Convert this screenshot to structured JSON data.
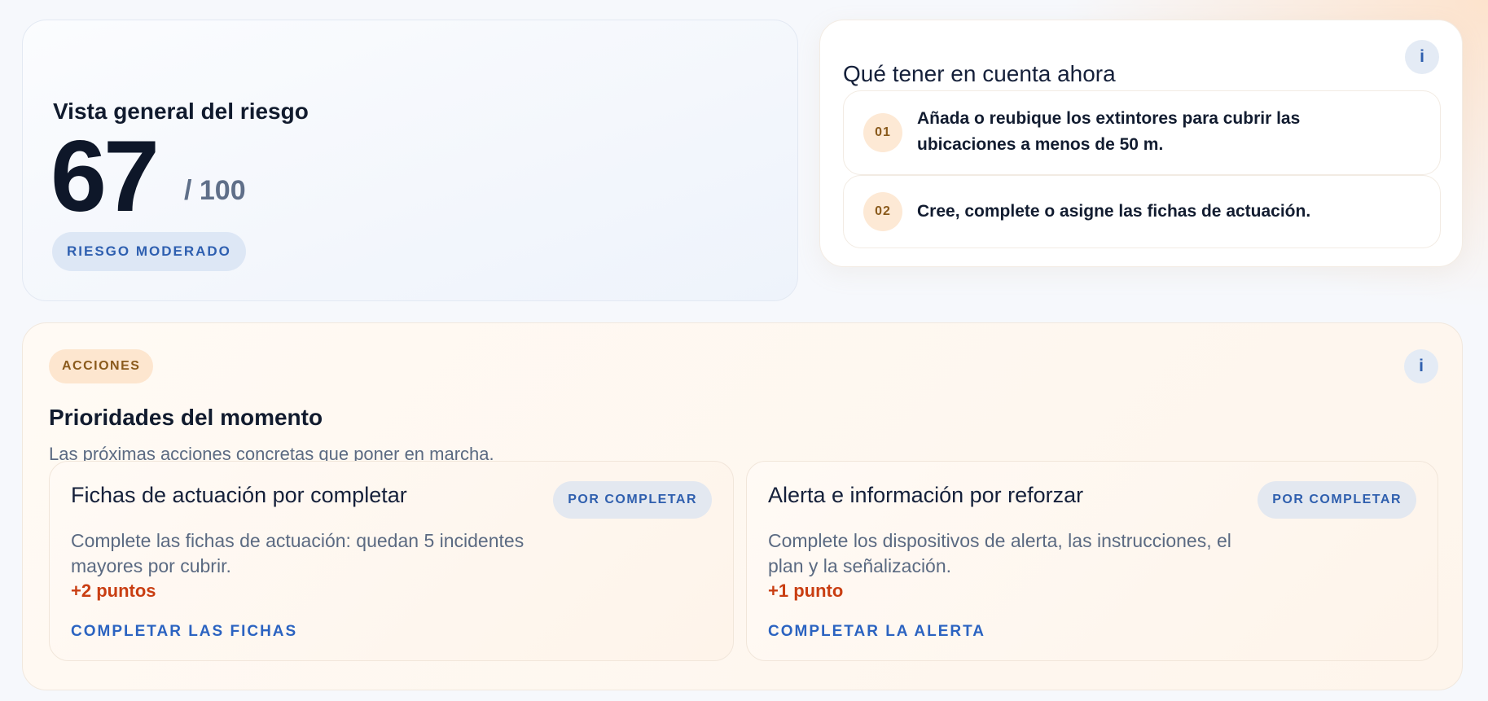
{
  "risk": {
    "title": "Vista general del riesgo",
    "score": "67",
    "max": "/ 100",
    "level_badge": "RIESGO MODERADO"
  },
  "tips": {
    "title": "Qué tener en cuenta ahora",
    "info_label": "i",
    "items": [
      {
        "num": "01",
        "text": "Añada o reubique los extintores para cubrir las ubicaciones a menos de 50 m."
      },
      {
        "num": "02",
        "text": "Cree, complete o asigne las fichas de actuación."
      }
    ]
  },
  "actions": {
    "badge": "ACCIONES",
    "info_label": "i",
    "title": "Prioridades del momento",
    "subtitle": "Las próximas acciones concretas que poner en marcha.",
    "cards": [
      {
        "title": "Fichas de actuación por completar",
        "status": "POR COMPLETAR",
        "description": "Complete las fichas de actuación: quedan 5 incidentes mayores por cubrir.",
        "points": "+2 puntos",
        "link": "COMPLETAR LAS FICHAS"
      },
      {
        "title": "Alerta e información por reforzar",
        "status": "POR COMPLETAR",
        "description": "Complete los dispositivos de alerta, las instrucciones, el plan y la señalización.",
        "points": "+1 punto",
        "link": "COMPLETAR LA ALERTA"
      }
    ]
  },
  "colors": {
    "accent_blue": "#2b63c1",
    "points_red": "#c93e12",
    "warm_badge": "#fde6cf"
  }
}
